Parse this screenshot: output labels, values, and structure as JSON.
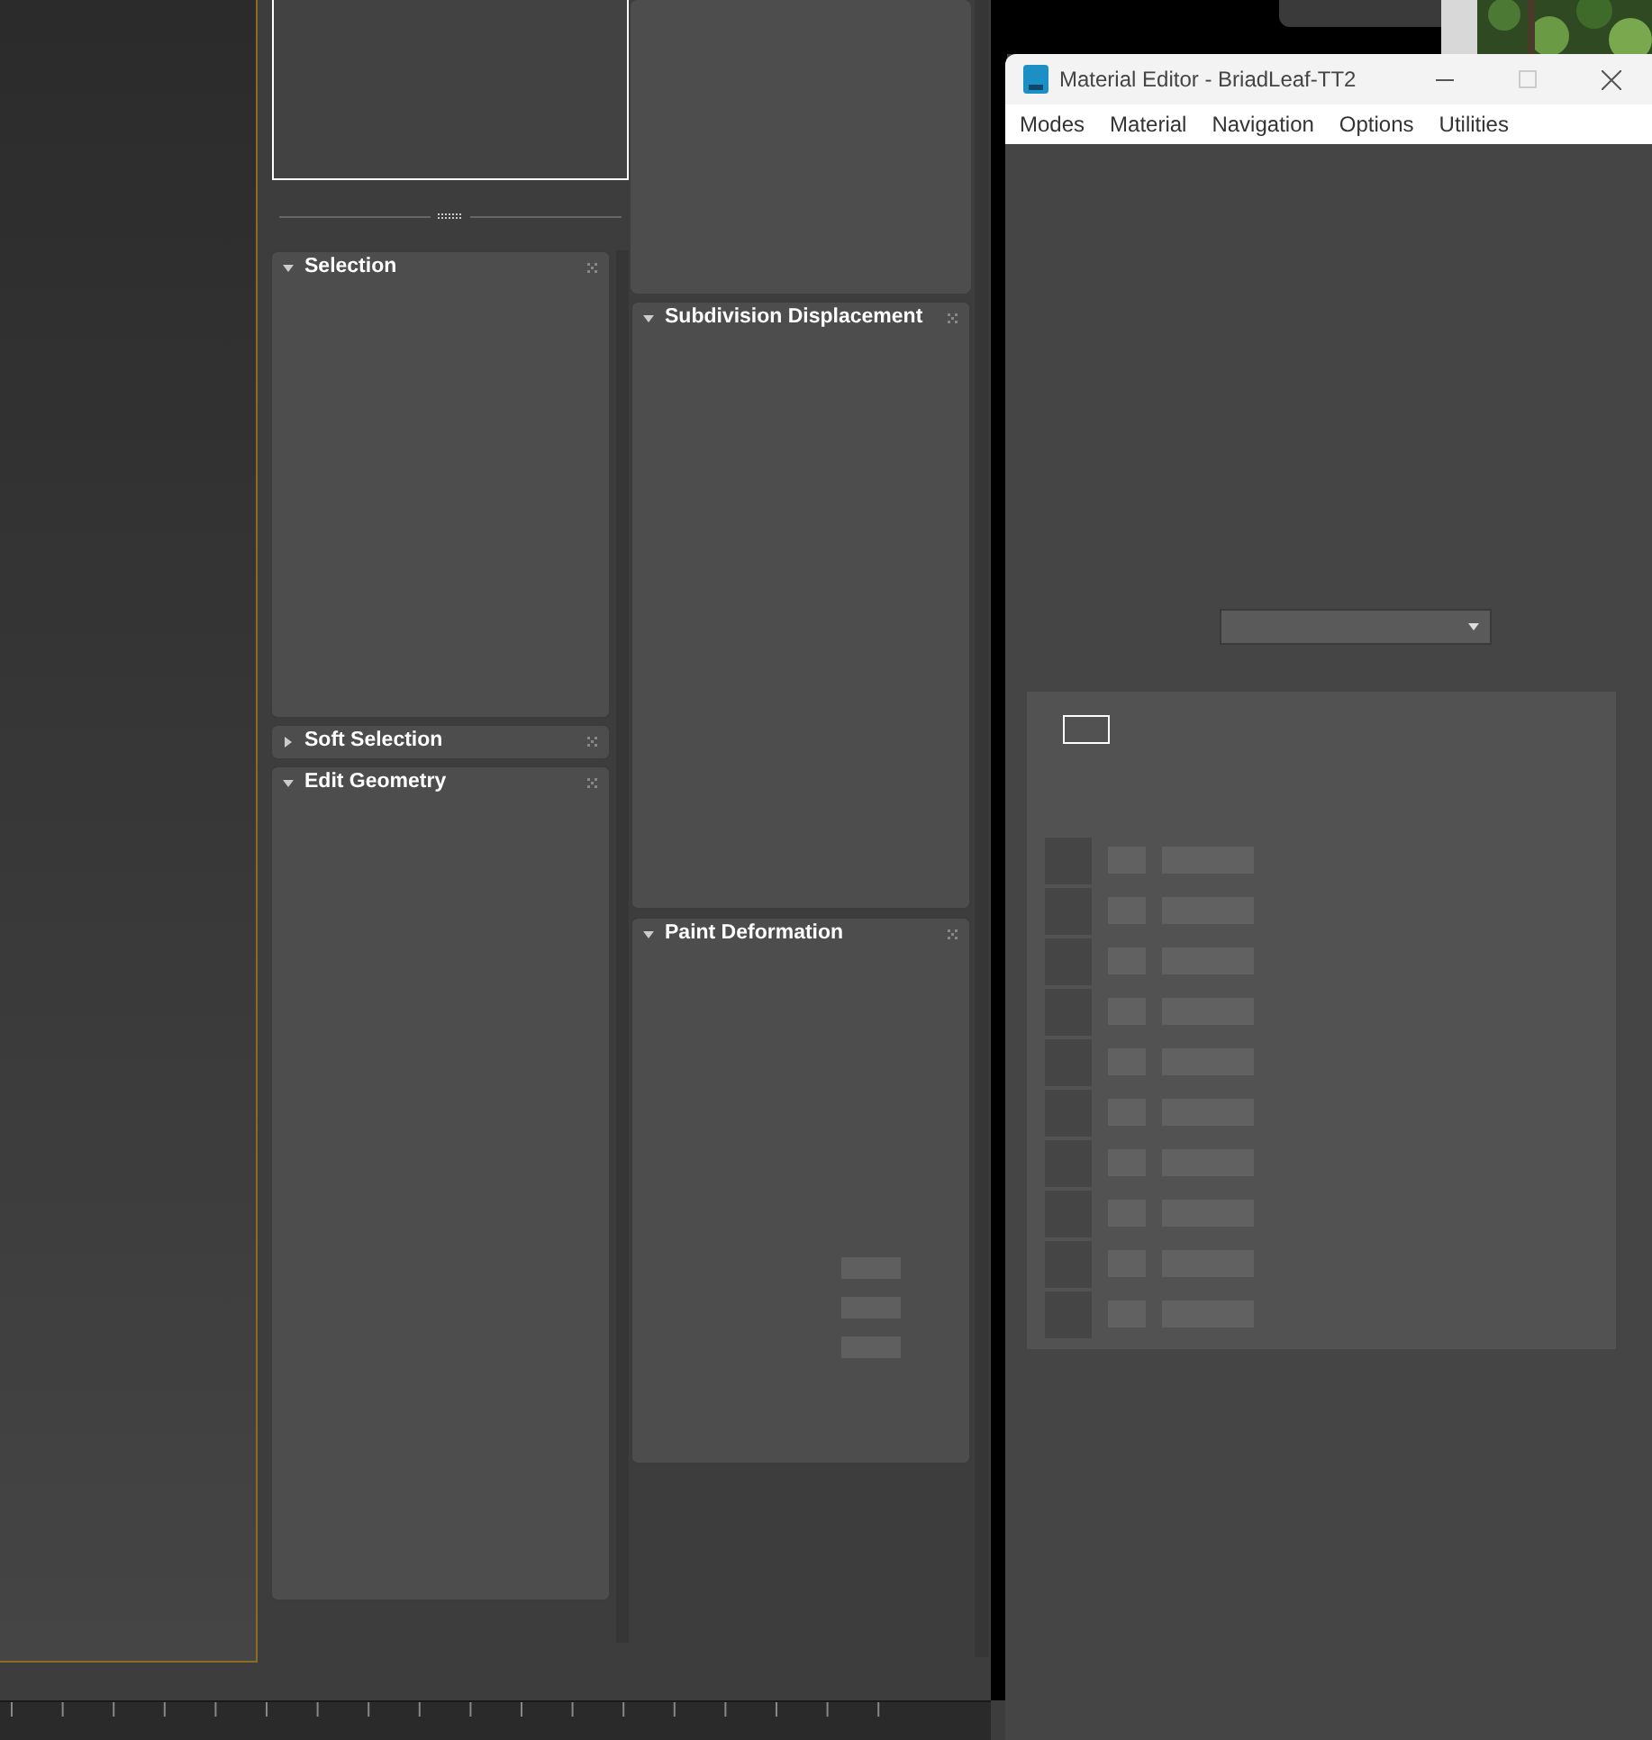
{
  "rollouts_left": [
    {
      "title": "Selection",
      "expanded": true
    },
    {
      "title": "Soft Selection",
      "expanded": false
    },
    {
      "title": "Edit Geometry",
      "expanded": true
    }
  ],
  "rollouts_right": [
    {
      "title": "Subdivision Displacement",
      "expanded": true
    },
    {
      "title": "Paint Deformation",
      "expanded": true
    }
  ],
  "material_editor": {
    "title": "Material Editor - BriadLeaf-TT2",
    "menu": [
      "Modes",
      "Material",
      "Navigation",
      "Options",
      "Utilities"
    ]
  }
}
